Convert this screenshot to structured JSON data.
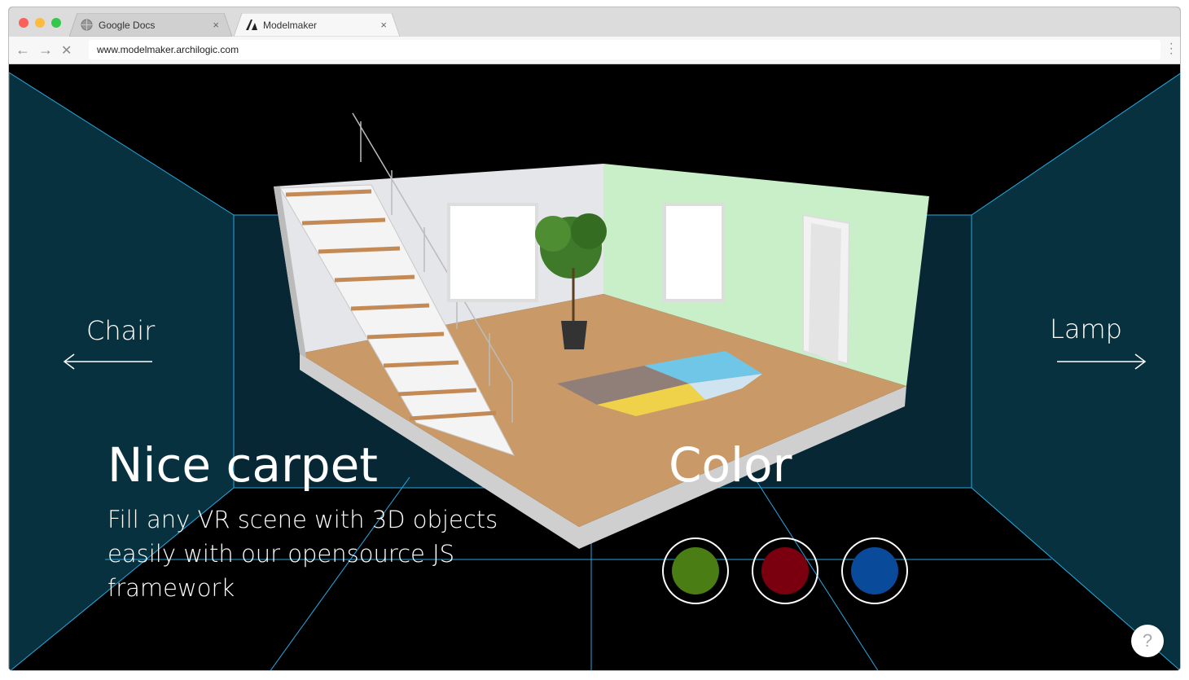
{
  "tabs": [
    {
      "title": "Google Docs",
      "icon": "globe-icon",
      "close": "×"
    },
    {
      "title": "Modelmaker",
      "icon": "archilogic-logo-icon",
      "close": "×"
    }
  ],
  "address_bar": {
    "url": "www.modelmaker.archilogic.com"
  },
  "nav": {
    "back": "←",
    "forward": "→",
    "stop": "✕"
  },
  "scene": {
    "prev_label": "Chair",
    "next_label": "Lamp",
    "headline": "Nice carpet",
    "description_lines": [
      "Fill any VR scene with 3D objects",
      "easily with our opensource JS",
      "framework"
    ],
    "color_title": "Color",
    "colors": [
      {
        "name": "green",
        "hex": "#4a7d14"
      },
      {
        "name": "red",
        "hex": "#7a0010"
      },
      {
        "name": "blue",
        "hex": "#0a4a9a"
      }
    ]
  },
  "help_label": "?",
  "accent": "#2aa8e0",
  "panel_color": "#08313f"
}
